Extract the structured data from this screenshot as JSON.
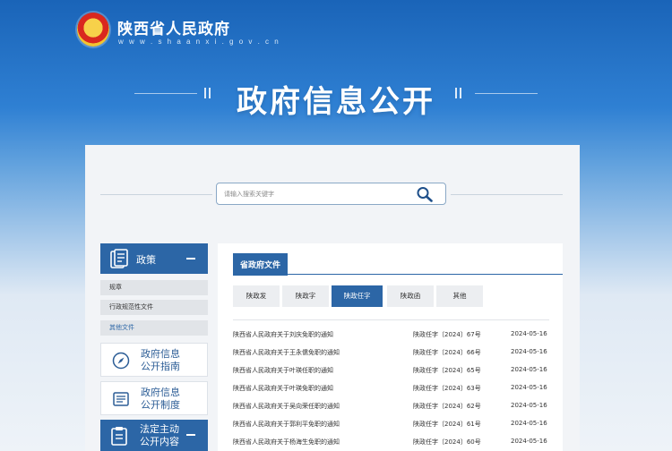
{
  "header": {
    "site_title": "陕西省人民政府",
    "site_domain": "w w w . s h a a n x i . g o v . c n",
    "hero_title": "政府信息公开"
  },
  "search": {
    "placeholder": "请输入搜索关键字"
  },
  "sidebar": {
    "policy": {
      "label": "政策",
      "items": [
        "规章",
        "行政规范性文件",
        "其他文件"
      ],
      "active_index": 2
    },
    "guide": {
      "line1": "政府信息",
      "line2": "公开指南"
    },
    "system": {
      "line1": "政府信息",
      "line2": "公开制度"
    },
    "proactive": {
      "line1": "法定主动",
      "line2": "公开内容"
    }
  },
  "content": {
    "section_title": "省政府文件",
    "categories": [
      "陕政发",
      "陕政字",
      "陕政任字",
      "陕政函",
      "其他"
    ],
    "active_category": 2,
    "rows": [
      {
        "title": "陕西省人民政府关于刘庆免职的通知",
        "number": "陕政任字〔2024〕67号",
        "date": "2024-05-16"
      },
      {
        "title": "陕西省人民政府关于王永儒免职的通知",
        "number": "陕政任字〔2024〕66号",
        "date": "2024-05-16"
      },
      {
        "title": "陕西省人民政府关于叶瑛任职的通知",
        "number": "陕政任字〔2024〕65号",
        "date": "2024-05-16"
      },
      {
        "title": "陕西省人民政府关于叶瑛免职的通知",
        "number": "陕政任字〔2024〕63号",
        "date": "2024-05-16"
      },
      {
        "title": "陕西省人民政府关于吴向荣任职的通知",
        "number": "陕政任字〔2024〕62号",
        "date": "2024-05-16"
      },
      {
        "title": "陕西省人民政府关于郭利平免职的通知",
        "number": "陕政任字〔2024〕61号",
        "date": "2024-05-16"
      },
      {
        "title": "陕西省人民政府关于杨海生免职的通知",
        "number": "陕政任字〔2024〕60号",
        "date": "2024-05-16"
      }
    ]
  },
  "colors": {
    "primary": "#2c66a6",
    "header_blue": "#1a64b8",
    "panel_bg": "#f2f4f7"
  }
}
